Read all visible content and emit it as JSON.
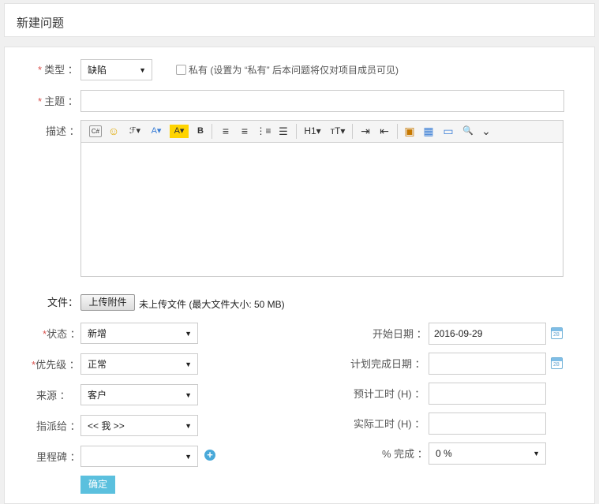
{
  "header": {
    "title": "新建问题"
  },
  "form": {
    "type": {
      "label": "类型",
      "value": "缺陷"
    },
    "private": {
      "label": "私有",
      "hint": "(设置为 “私有” 后本问题将仅对项目成员可见)"
    },
    "subject": {
      "label": "主题",
      "value": ""
    },
    "description": {
      "label": "描述",
      "toolbar": {
        "code": "C#",
        "emoji": "☺",
        "font": "ℱ▾",
        "font_color": "A▾",
        "highlight": "A▾",
        "bold": "B",
        "align_left": "≡",
        "align_center": "≡",
        "ordered_list": "⋮≡",
        "unordered_list": "☰",
        "heading": "H1▾",
        "font_size": "ᴛT▾",
        "indent": "⇥",
        "outdent": "⇤",
        "image": "▣",
        "table": "▦",
        "media": "▭",
        "preview": "🔍",
        "more": "⌄"
      }
    },
    "file": {
      "label": "文件",
      "button": "上传附件",
      "info": "未上传文件 (最大文件大小: 50 MB)"
    },
    "status": {
      "label": "状态",
      "value": "新增"
    },
    "priority": {
      "label": "优先级",
      "value": "正常"
    },
    "source": {
      "label": "来源",
      "value": "客户"
    },
    "assignee": {
      "label": "指派给",
      "value": "<< 我 >>"
    },
    "milestone": {
      "label": "里程碑",
      "value": ""
    },
    "start_date": {
      "label": "开始日期",
      "value": "2016-09-29"
    },
    "due_date": {
      "label": "计划完成日期",
      "value": ""
    },
    "estimated_hours": {
      "label": "预计工时 (H)",
      "value": ""
    },
    "spent_hours": {
      "label": "实际工时 (H)",
      "value": ""
    },
    "done_ratio": {
      "label": "% 完成",
      "value": "0 %"
    },
    "calendar_day": "28",
    "colon": "：",
    "submit": "确定"
  },
  "colors": {
    "accent": "#5bc0de",
    "required": "#d9534f",
    "plus": "#49a9d9"
  }
}
